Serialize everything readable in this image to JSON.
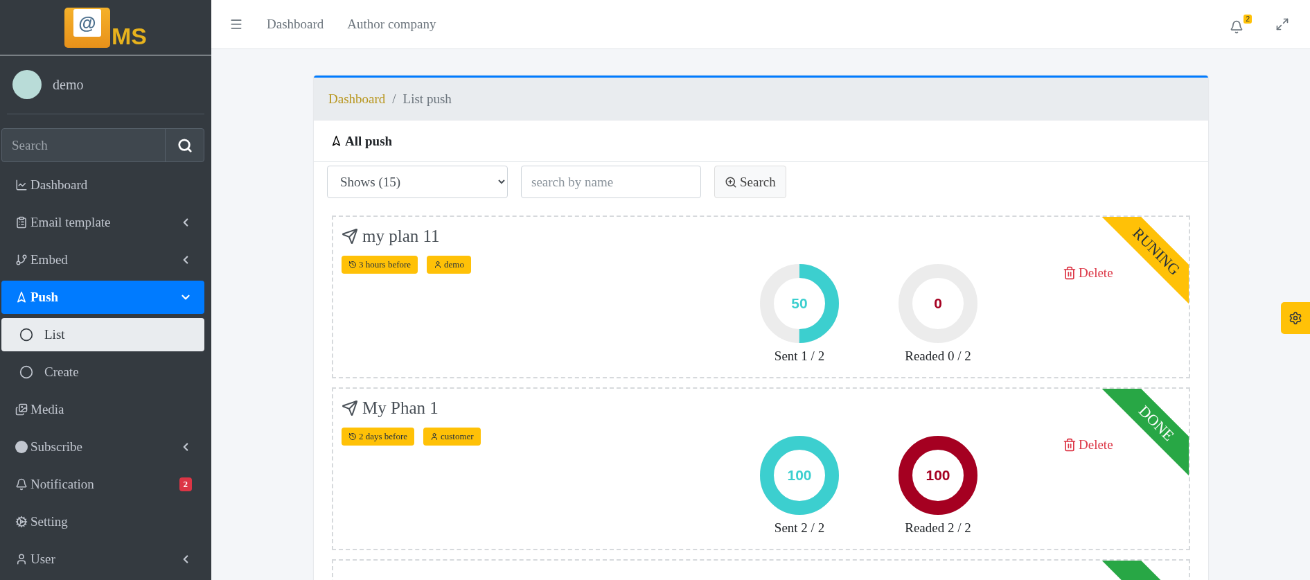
{
  "logo": {
    "mark": "@",
    "text": "MS"
  },
  "user": {
    "name": "demo"
  },
  "sidebar_search": {
    "placeholder": "Search"
  },
  "sidebar": {
    "items": [
      {
        "label": "Dashboard",
        "submenu": false,
        "selected": false
      },
      {
        "label": "Email template",
        "submenu": true,
        "expanded": false,
        "selected": false
      },
      {
        "label": "Embed",
        "submenu": true,
        "expanded": false,
        "selected": false
      },
      {
        "label": "Push",
        "submenu": true,
        "expanded": true,
        "selected": true,
        "children": [
          {
            "label": "List",
            "selected": true
          },
          {
            "label": "Create",
            "selected": false
          }
        ]
      },
      {
        "label": "Media",
        "submenu": false,
        "selected": false
      },
      {
        "label": "Subscribe",
        "submenu": true,
        "expanded": false,
        "selected": false
      },
      {
        "label": "Notification",
        "submenu": false,
        "selected": false,
        "badge": "2"
      },
      {
        "label": "Setting",
        "submenu": false,
        "selected": false
      },
      {
        "label": "User",
        "submenu": true,
        "expanded": false,
        "selected": false
      }
    ]
  },
  "topbar": {
    "links": [
      "Dashboard",
      "Author company"
    ],
    "notification_count": "2"
  },
  "breadcrumb": [
    "Dashboard",
    "List push"
  ],
  "breadcrumb_separator": "/",
  "panel_title": "All push",
  "filters": {
    "shows": "Shows (15)",
    "search_placeholder": "search by name",
    "search_button": "Search"
  },
  "pushes": [
    {
      "title": "my plan 11",
      "time": "3 hours before",
      "author": "demo",
      "color": "#ffc107",
      "status_label": "RUNING",
      "delete": "Delete",
      "sent": {
        "value": "50",
        "level": 0.5,
        "caption": "Sent 1 / 2"
      },
      "read": {
        "value": "0",
        "level": 0,
        "caption": "Readed 0 / 2"
      }
    },
    {
      "title": "My Phan 1",
      "time": "2 days before",
      "author": "customer",
      "color": "#28a745",
      "status_label": "DONE",
      "delete": "Delete",
      "sent": {
        "value": "100",
        "level": 1,
        "caption": "Sent 2 / 2"
      },
      "read": {
        "value": "100",
        "level": 1,
        "caption": "Readed 2 / 2"
      }
    }
  ],
  "partial_push": {
    "color": "#28a745"
  }
}
